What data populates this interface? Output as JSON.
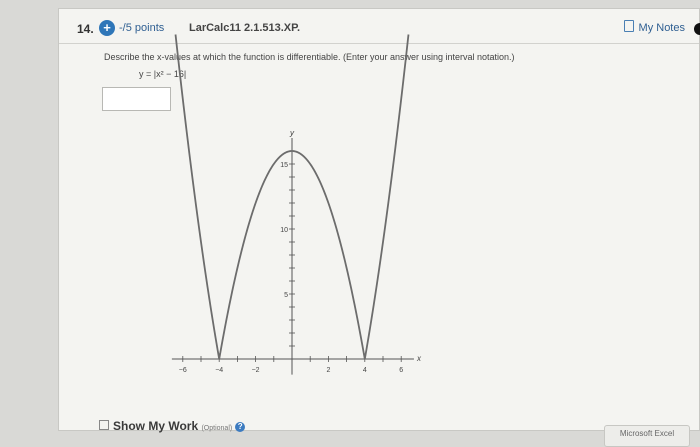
{
  "question": {
    "number": "14.",
    "points": "-/5 points",
    "source": "LarCalc11 2.1.513.XP.",
    "my_notes": "My Notes",
    "prompt": "Describe the x-values at which the function is differentiable. (Enter your answer using interval notation.)",
    "formula": "y = |x² − 16|",
    "answer_value": ""
  },
  "graph": {
    "x_axis_label": "x",
    "y_axis_label": "y",
    "x_tick_labels": [
      "−6",
      "−4",
      "−2",
      "2",
      "4",
      "6"
    ],
    "y_tick_labels": [
      "5",
      "10",
      "15"
    ]
  },
  "footer": {
    "show_work": "Show My Work",
    "optional": "(Optional)",
    "excel": "Microsoft Excel"
  },
  "chart_data": {
    "type": "line",
    "x": [
      -6.4,
      -6,
      -5,
      -4,
      -3,
      -2,
      -1,
      0,
      1,
      2,
      3,
      4,
      5,
      6,
      6.4
    ],
    "y": [
      24.96,
      20,
      9,
      0,
      7,
      12,
      15,
      16,
      15,
      12,
      7,
      0,
      9,
      20,
      24.96
    ],
    "xlabel": "x",
    "ylabel": "y",
    "xlim": [
      -7,
      7
    ],
    "ylim": [
      -1,
      17
    ]
  }
}
